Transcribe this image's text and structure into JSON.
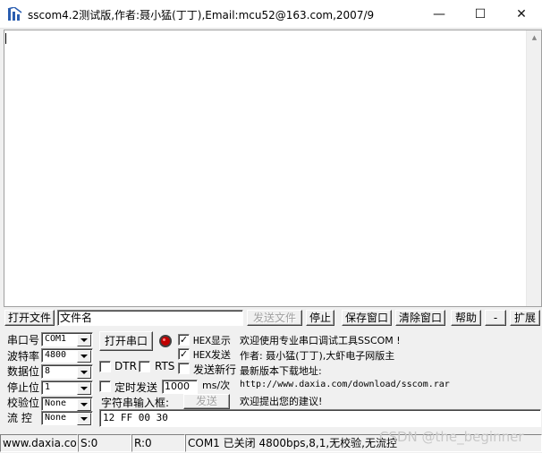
{
  "window": {
    "title": "sscom4.2测试版,作者:聂小猛(丁丁),Email:mcu52@163.com,2007/9",
    "minimize_glyph": "—",
    "maximize_glyph": "☐",
    "close_glyph": "✕"
  },
  "toolbar": {
    "open_file": "打开文件",
    "filename": "文件名",
    "send_file": "发送文件",
    "stop": "停止",
    "save_window": "保存窗口",
    "clear_window": "清除窗口",
    "help": "帮助",
    "dash": "-",
    "expand": "扩展"
  },
  "port": {
    "port_label": "串口号",
    "port_value": "COM1",
    "baud_label": "波特率",
    "baud_value": "4800",
    "databits_label": "数据位",
    "databits_value": "8",
    "stopbits_label": "停止位",
    "stopbits_value": "1",
    "parity_label": "校验位",
    "parity_value": "None",
    "flow_label": "流 控",
    "flow_value": "None",
    "open_port": "打开串口"
  },
  "options": {
    "hex_display": "HEX显示",
    "hex_send": "HEX发送",
    "dtr": "DTR",
    "rts": "RTS",
    "send_newline": "发送新行",
    "timed_send": "定时发送",
    "interval_value": "1000",
    "interval_unit": "ms/次",
    "input_label": "字符串输入框:",
    "send": "发送",
    "send_text": "12 FF 00 30",
    "check_mark": "✓"
  },
  "info": {
    "line1": "欢迎使用专业串口调试工具SSCOM !",
    "line2": "作者: 聂小猛(丁丁),大虾电子网版主",
    "line3": "最新版本下载地址:",
    "line4": "http://www.daxia.com/download/sscom.rar",
    "line5": "欢迎提出您的建议!"
  },
  "status": {
    "site": "www.daxia.com",
    "sent": "S:0",
    "received": "R:0",
    "port_state": "COM1 已关闭  4800bps,8,1,无校验,无流控"
  },
  "watermark": "CSDN @the_beginner",
  "colors": {
    "led": "#c00000",
    "title_icon": "#2a5db0"
  }
}
